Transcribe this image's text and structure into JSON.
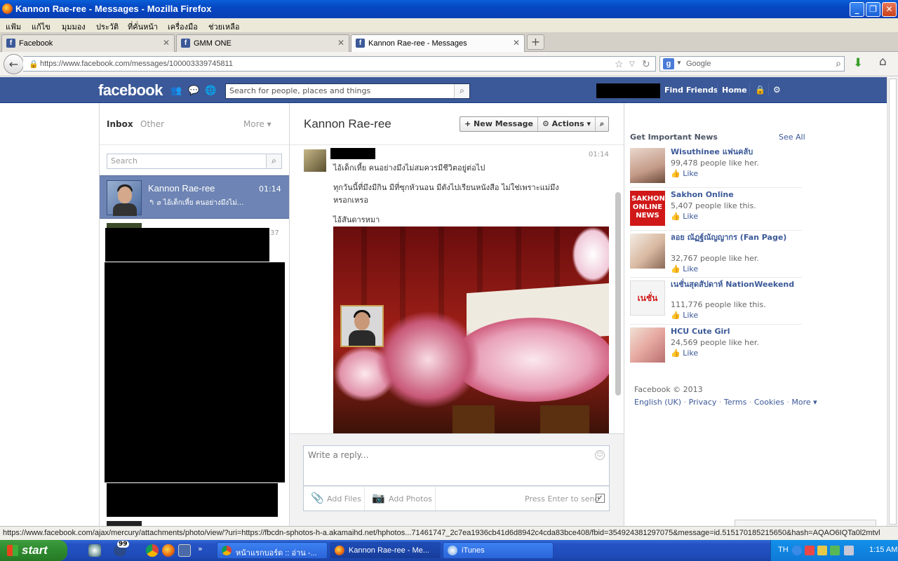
{
  "window": {
    "title": "Kannon Rae-ree - Messages - Mozilla Firefox"
  },
  "menu": [
    "แฟ้ม",
    "แก้ไข",
    "มุมมอง",
    "ประวัติ",
    "ที่คั่นหน้า",
    "เครื่องมือ",
    "ช่วยเหลือ"
  ],
  "tabs": [
    {
      "label": "Facebook"
    },
    {
      "label": "GMM ONE"
    },
    {
      "label": "Kannon Rae-ree - Messages"
    }
  ],
  "address": {
    "url": "https://www.facebook.com/messages/100003339745811"
  },
  "search_engine": {
    "placeholder": "Google"
  },
  "fb": {
    "logo": "facebook",
    "search_placeholder": "Search for people, places and things",
    "find_friends": "Find Friends",
    "home": "Home"
  },
  "inbox": {
    "tab_inbox": "Inbox",
    "tab_other": "Other",
    "more": "More ▾",
    "search_placeholder": "Search",
    "threads": [
      {
        "name": "Kannon Rae-ree",
        "time": "01:14",
        "snippet": "↰ ⌀ ไอ้เด็กเหี้ย คนอย่างมึงไม่...",
        "selected": true
      },
      {
        "time": "37"
      }
    ]
  },
  "conversation": {
    "name": "Kannon Rae-ree",
    "new_message": "+ New Message",
    "actions": "⚙ Actions ▾",
    "time": "01:14",
    "lines": [
      "ไอ้เด็กเหี้ย คนอย่างมึงไม่สมควรมีชีวิตอยู่ต่อไป",
      "ทุกวันนี้ที่มึงมีกิน มีที่ซุกหัวนอน มีตังไปเรียนหนังสือ ไม่ใช่เพราะแม่มึงหรอกเหรอ",
      "ไอ้สันดารหมา"
    ],
    "reply_placeholder": "Write a reply...",
    "add_files": "Add Files",
    "add_photos": "Add Photos",
    "press_enter": "Press Enter to send"
  },
  "sidebar": {
    "title": "Get Important News",
    "see_all": "See All",
    "like_label": "Like",
    "pages": [
      {
        "name": "Wisuthinee แฟนคลับ",
        "count": "99,478 people like her."
      },
      {
        "name": "Sakhon Online",
        "count": "5,407 people like this.",
        "thumb_text": "SAKHON ONLINE NEWS"
      },
      {
        "name": "ลอย ณัฏฐ์ณัญญากร (Fan Page)",
        "count": "32,767 people like her."
      },
      {
        "name": "เนชั่นสุดสัปดาห์ NationWeekend",
        "count": "111,776 people like this.",
        "thumb_text": "เนชั่น"
      },
      {
        "name": "HCU Cute Girl",
        "count": "24,569 people like her."
      }
    ],
    "copyright": "Facebook © 2013",
    "footer_links": [
      "English (UK)",
      "Privacy",
      "Terms",
      "Cookies",
      "More ▾"
    ]
  },
  "status_url": "https://www.facebook.com/ajax/mercury/attachments/photo/view/?uri=https://fbcdn-sphotos-h-a.akamaihd.net/hphotos...71461747_2c7ea1936cb41d6d8942c4cda83bce408/fbid=354924381297075&message=id.515170185215650&hash=AQAO6IQTa0l2mtvl",
  "taskbar": {
    "start": "start",
    "badge": "99",
    "tasks": [
      {
        "label": "หน้าแรกบอร์ด :: อ่าน -..."
      },
      {
        "label": "Kannon Rae-ree - Me..."
      },
      {
        "label": "iTunes"
      }
    ],
    "lang": "TH",
    "clock": "1:15 AM"
  }
}
